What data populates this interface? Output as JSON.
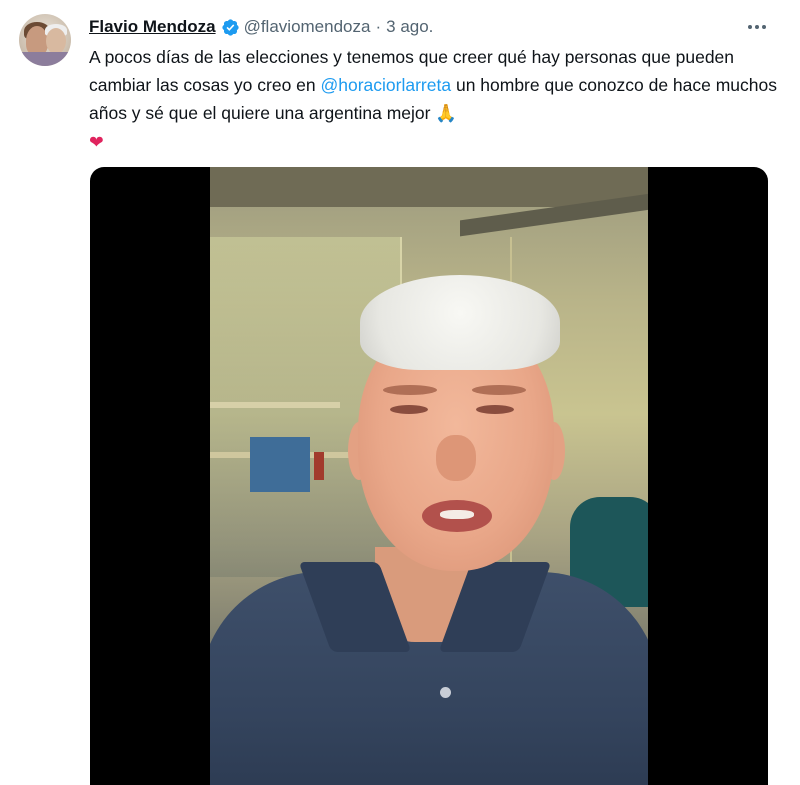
{
  "tweet": {
    "author_name": "Flavio Mendoza",
    "handle": "@flaviomendoza",
    "separator": "·",
    "date": "3 ago.",
    "text_before": "A pocos días de las elecciones y tenemos que creer qué hay personas que pueden cambiar las cosas yo creo en ",
    "mention": "@horaciorlarreta",
    "text_after": " un hombre que conozco de hace muchos años y sé que el quiere una argentina mejor ",
    "emoji_pray": "🙏",
    "emoji_heart": "❤",
    "verified": true,
    "icons": {
      "verified": "verified-badge-icon",
      "more": "more-options-icon"
    }
  },
  "colors": {
    "text": "#0f1419",
    "secondary": "#536471",
    "link": "#1d9bf0",
    "verified": "#1d9bf0",
    "heart": "#e0245e"
  }
}
